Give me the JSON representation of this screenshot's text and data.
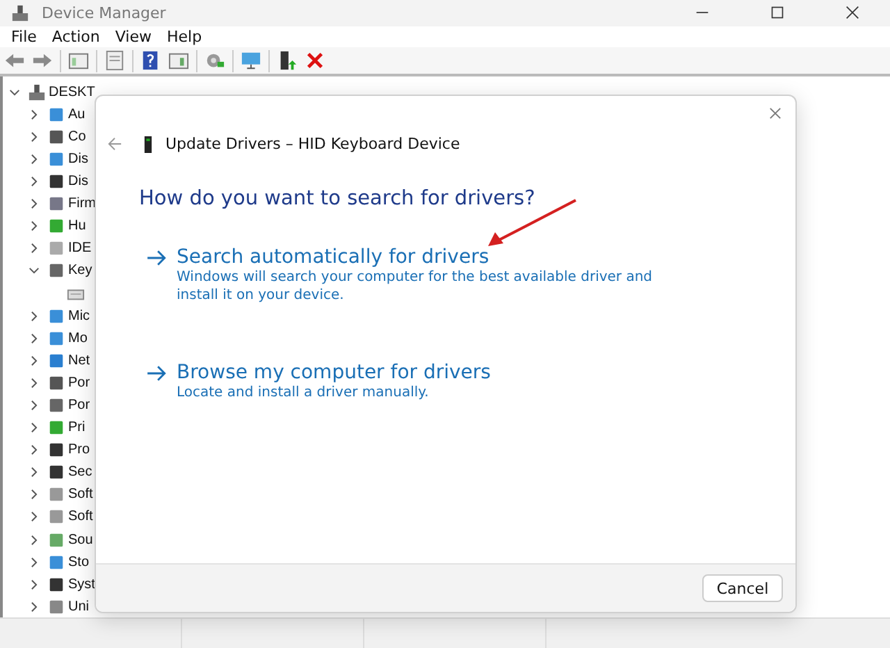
{
  "window": {
    "title": "Device Manager"
  },
  "menu": [
    "File",
    "Action",
    "View",
    "Help"
  ],
  "tree": [
    {
      "label": "DESKT",
      "expanded": true,
      "children": [
        {
          "label": "Au",
          "expanded": false
        },
        {
          "label": "Co",
          "expanded": false
        },
        {
          "label": "Dis",
          "expanded": false
        },
        {
          "label": "Dis",
          "expanded": false
        },
        {
          "label": "Firm",
          "expanded": false
        },
        {
          "label": "Hu",
          "expanded": false
        },
        {
          "label": "IDE",
          "expanded": false
        },
        {
          "label": "Key",
          "expanded": true,
          "children": [
            {
              "kind": "leaf"
            }
          ]
        },
        {
          "label": "Mic",
          "expanded": false
        },
        {
          "label": "Mo",
          "expanded": false
        },
        {
          "label": "Net",
          "expanded": false
        },
        {
          "label": "Por",
          "expanded": false
        },
        {
          "label": "Por",
          "expanded": false
        },
        {
          "label": "Pri",
          "expanded": false
        },
        {
          "label": "Pro",
          "expanded": false
        },
        {
          "label": "Sec",
          "expanded": false
        },
        {
          "label": "Soft",
          "expanded": false
        },
        {
          "label": "Soft",
          "expanded": false
        },
        {
          "label": "Sou",
          "expanded": false
        },
        {
          "label": "Sto",
          "expanded": false
        },
        {
          "label": "Syst",
          "expanded": false
        },
        {
          "label": "Uni",
          "expanded": false
        }
      ]
    }
  ],
  "dialog": {
    "title": "Update Drivers – HID Keyboard Device",
    "heading": "How do you want to search for drivers?",
    "options": [
      {
        "title": "Search automatically for drivers",
        "description": "Windows will search your computer for the best available driver and install it on your device.",
        "annotated": true
      },
      {
        "title": "Browse my computer for drivers",
        "description": "Locate and install a driver manually.",
        "annotated": false
      }
    ],
    "buttons": [
      "Cancel"
    ]
  }
}
